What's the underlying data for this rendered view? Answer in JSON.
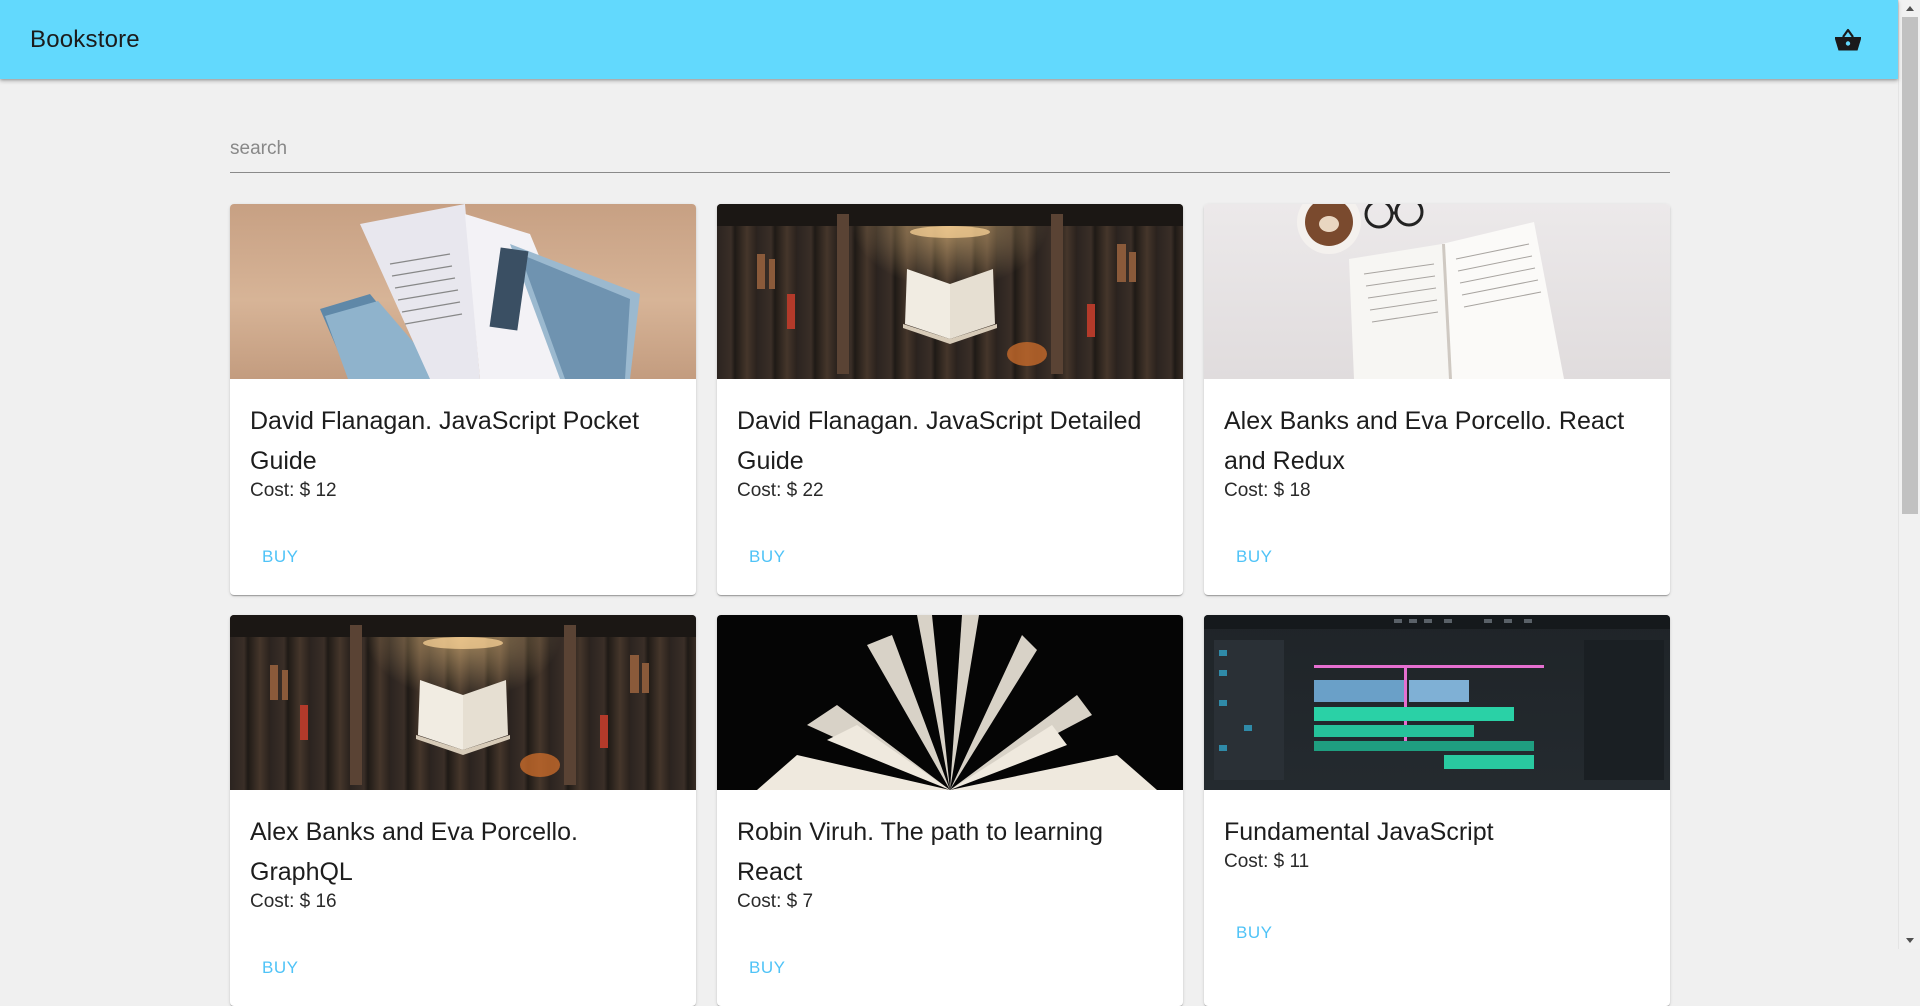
{
  "app": {
    "title": "Bookstore"
  },
  "search": {
    "placeholder": "search",
    "value": ""
  },
  "books": [
    {
      "title": "David Flanagan. JavaScript Pocket Guide",
      "cost": "Cost: $ 12",
      "buy": "BUY",
      "image": "open-book-fanned-pages"
    },
    {
      "title": "David Flanagan. JavaScript Detailed Guide",
      "cost": "Cost: $ 22",
      "buy": "BUY",
      "image": "floating-book-library"
    },
    {
      "title": "Alex Banks and Eva Porcello. React and Redux",
      "cost": "Cost: $ 18",
      "buy": "BUY",
      "image": "open-book-coffee-glasses"
    },
    {
      "title": "Alex Banks and Eva Porcello. GraphQL",
      "cost": "Cost: $ 16",
      "buy": "BUY",
      "image": "floating-book-library"
    },
    {
      "title": "Robin Viruh. The path to learning React",
      "cost": "Cost: $ 7",
      "buy": "BUY",
      "image": "book-pages-dark"
    },
    {
      "title": "Fundamental JavaScript",
      "cost": "Cost: $ 11",
      "buy": "BUY",
      "image": "video-editor-timeline"
    }
  ],
  "icons": {
    "cart": "shopping-basket-icon"
  },
  "colors": {
    "appbar": "#62d9fd",
    "accent": "#4fc3f7",
    "background": "#f0f0f0"
  }
}
